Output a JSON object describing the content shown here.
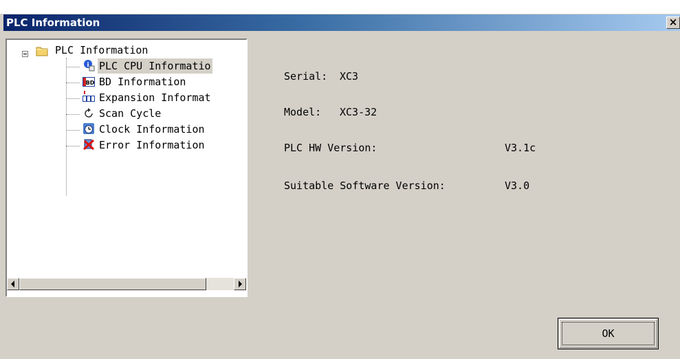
{
  "dialog": {
    "title": "PLC Information",
    "close_label": "×"
  },
  "tree": {
    "root_label": "PLC Information",
    "items": [
      {
        "label": "PLC CPU Informatio",
        "icon": "info-icon",
        "selected": true
      },
      {
        "label": "BD Information",
        "icon": "bd-icon",
        "selected": false
      },
      {
        "label": "Expansion Informat",
        "icon": "expansion-icon",
        "selected": false
      },
      {
        "label": "Scan Cycle",
        "icon": "refresh-icon",
        "selected": false
      },
      {
        "label": "Clock Information",
        "icon": "clock-icon",
        "selected": false
      },
      {
        "label": "Error Information",
        "icon": "error-icon",
        "selected": false
      }
    ]
  },
  "info": {
    "serial_label": "Serial:",
    "serial_value": "XC3",
    "model_label": "Model:",
    "model_value": "XC3-32",
    "hw_label": "PLC HW Version:",
    "hw_value": "V3.1c",
    "sw_label": "Suitable Software Version:",
    "sw_value": "V3.0"
  },
  "buttons": {
    "ok_label": "OK"
  },
  "colors": {
    "title_start": "#0a246a",
    "title_end": "#a6caf0",
    "face": "#d4d0c8"
  }
}
